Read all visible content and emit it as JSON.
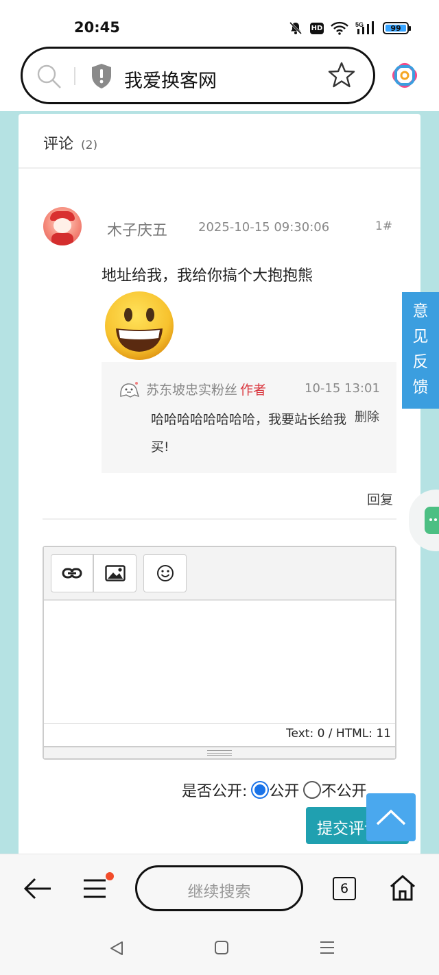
{
  "status_bar": {
    "time": "20:45",
    "network": "5G",
    "battery": "99"
  },
  "address_bar": {
    "site_name": "我爱换客网"
  },
  "side_feedback": {
    "label": "意见反馈"
  },
  "comments_section": {
    "title": "评论",
    "count": "(2)"
  },
  "comment": {
    "author": "木子庆五",
    "time": "2025-10-15 09:30:06",
    "floor": "1#",
    "text": "地址给我，我给你搞个大抱抱熊",
    "emoji": "grinning-face-emoji",
    "reply": {
      "author": "苏东坡忠实粉丝",
      "badge": "作者",
      "time": "10-15 13:01",
      "text": "哈哈哈哈哈哈哈哈，我要站长给我买!",
      "delete_label": "删除"
    },
    "reply_label": "回复"
  },
  "editor": {
    "toolbar": [
      "link-icon",
      "image-icon",
      "emoji-icon"
    ],
    "counter": "Text: 0 / HTML: 11"
  },
  "visibility": {
    "label": "是否公开:",
    "options": [
      {
        "label": "公开",
        "checked": true
      },
      {
        "label": "不公开",
        "checked": false
      }
    ]
  },
  "submit_label": "提交评论",
  "bottom_bar": {
    "search_placeholder": "继续搜索",
    "tab_count": "6"
  },
  "colors": {
    "page_bg": "#b5e2e3",
    "feedback": "#3b9edf",
    "submit": "#20a0b0",
    "author_badge": "#d9363e",
    "back_top": "#4aa8ee"
  }
}
